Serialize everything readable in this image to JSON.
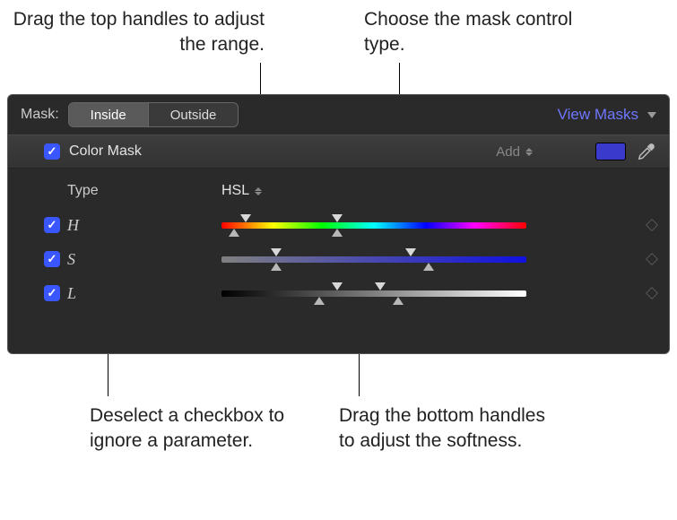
{
  "callouts": {
    "top_left": "Drag the top handles to adjust the range.",
    "top_right": "Choose the mask control type.",
    "bottom_left": "Deselect a checkbox to ignore a parameter.",
    "bottom_right": "Drag the bottom handles to adjust the softness."
  },
  "panel": {
    "mask_label": "Mask:",
    "seg_inside": "Inside",
    "seg_outside": "Outside",
    "view_masks": "View Masks",
    "section_title": "Color Mask",
    "add_dropdown": "Add",
    "type_label": "Type",
    "type_value": "HSL",
    "params": [
      {
        "label": "H",
        "checked": true,
        "gradient": "hue",
        "range": [
          8,
          38
        ],
        "soft": [
          4,
          38
        ]
      },
      {
        "label": "S",
        "checked": true,
        "gradient": "sat",
        "range": [
          18,
          62
        ],
        "soft": [
          18,
          68
        ]
      },
      {
        "label": "L",
        "checked": true,
        "gradient": "lum",
        "range": [
          38,
          52
        ],
        "soft": [
          32,
          58
        ]
      }
    ]
  },
  "colors": {
    "swatch": "#3a3acc"
  }
}
